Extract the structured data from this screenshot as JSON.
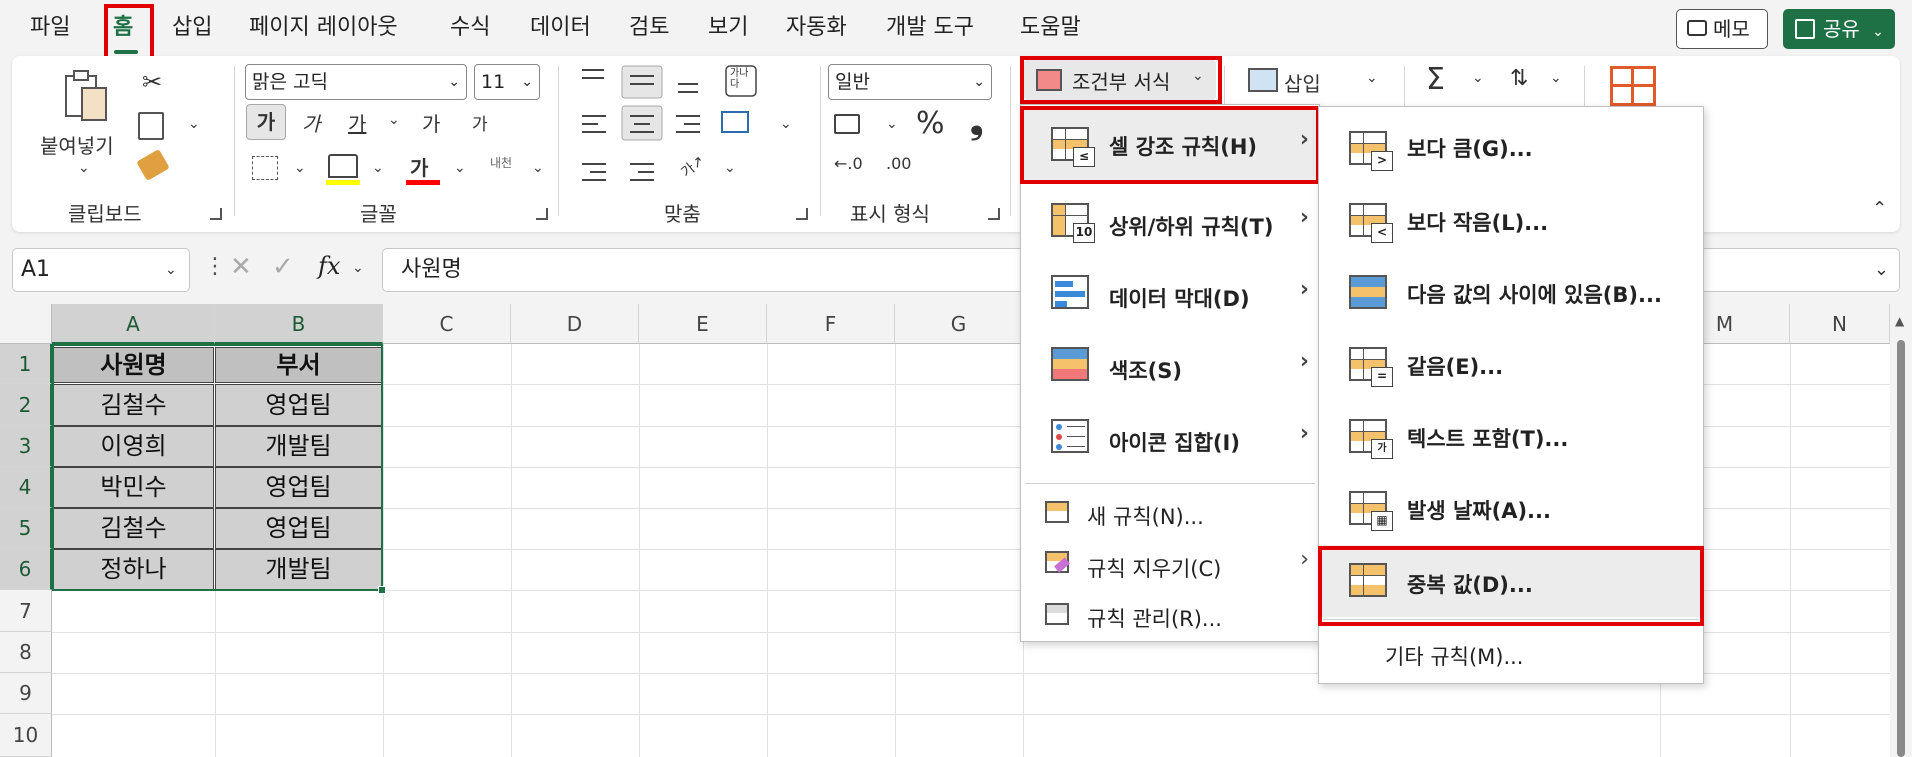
{
  "menubar": {
    "tabs": [
      "파일",
      "홈",
      "삽입",
      "페이지 레이아웃",
      "수식",
      "데이터",
      "검토",
      "보기",
      "자동화",
      "개발 도구",
      "도움말"
    ],
    "memo_label": "메모",
    "share_label": "공유"
  },
  "ribbon": {
    "clipboard": {
      "paste_label": "붙여넣기",
      "group_label": "클립보드"
    },
    "font": {
      "font_name": "맑은 고딕",
      "font_size": "11",
      "bold": "가",
      "italic": "가",
      "underline": "가",
      "grow": "가",
      "shrink": "가",
      "color_char": "가",
      "phonetic": "내천",
      "group_label": "글꼴"
    },
    "alignment": {
      "orient": "가나다",
      "group_label": "맞춤"
    },
    "number": {
      "format": "일반",
      "percent": "%",
      "comma": "❟",
      "inc_dec": ".0",
      "dec_dec": ".00",
      "group_label": "표시 형식"
    },
    "styles": {
      "cond_format_label": "조건부 서식"
    },
    "cells": {
      "insert_label": "삽입"
    },
    "editing": {
      "sum_symbol": "Σ"
    }
  },
  "formula_bar": {
    "name_box": "A1",
    "fx": "fx",
    "content": "사원명"
  },
  "sheet": {
    "columns": [
      "A",
      "B",
      "C",
      "D",
      "E",
      "F",
      "G",
      "M",
      "N"
    ],
    "rows": [
      "1",
      "2",
      "3",
      "4",
      "5",
      "6",
      "7",
      "8",
      "9",
      "10"
    ],
    "table": [
      [
        "사원명",
        "부서"
      ],
      [
        "김철수",
        "영업팀"
      ],
      [
        "이영희",
        "개발팀"
      ],
      [
        "박민수",
        "영업팀"
      ],
      [
        "김철수",
        "영업팀"
      ],
      [
        "정하나",
        "개발팀"
      ]
    ]
  },
  "cond_menu": {
    "items": [
      {
        "label": "셀 강조 규칙(H)"
      },
      {
        "label": "상위/하위 규칙(T)"
      },
      {
        "label": "데이터 막대(D)"
      },
      {
        "label": "색조(S)"
      },
      {
        "label": "아이콘 집합(I)"
      }
    ],
    "small_items": [
      {
        "label": "새 규칙(N)..."
      },
      {
        "label": "규칙 지우기(C)"
      },
      {
        "label": "규칙 관리(R)..."
      }
    ]
  },
  "highlight_menu": {
    "items": [
      {
        "label": "보다 큼(G)..."
      },
      {
        "label": "보다 작음(L)..."
      },
      {
        "label": "다음 값의 사이에 있음(B)..."
      },
      {
        "label": "같음(E)..."
      },
      {
        "label": "텍스트 포함(T)..."
      },
      {
        "label": "발생 날짜(A)..."
      },
      {
        "label": "중복 값(D)..."
      }
    ],
    "more_rules": "기타 규칙(M)..."
  },
  "colors": {
    "accent": "#1e7145",
    "highlight_box": "#e00000",
    "cell_fill": "#d0d0d0",
    "icon_fill": "#f5c26b"
  }
}
